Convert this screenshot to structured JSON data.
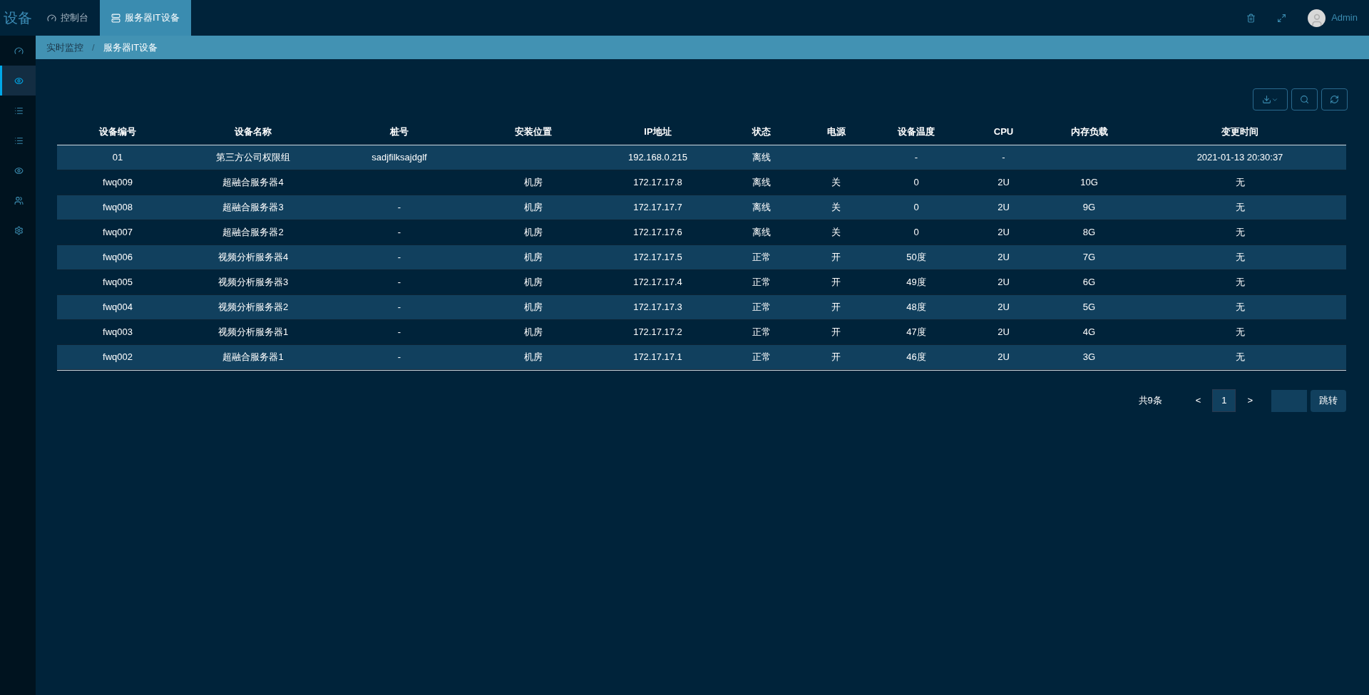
{
  "header": {
    "logo": "设备",
    "tabs": [
      {
        "label": "控制台",
        "selected": false
      },
      {
        "label": "服务器IT设备",
        "selected": true
      }
    ],
    "user": "Admin"
  },
  "sidebar": {
    "items": [
      {
        "selected": false
      },
      {
        "selected": true
      },
      {
        "selected": false
      },
      {
        "selected": false
      },
      {
        "selected": false
      },
      {
        "selected": false
      },
      {
        "selected": false
      }
    ]
  },
  "breadcrumb": {
    "items": [
      "实时监控",
      "服务器IT设备"
    ],
    "separator": "/"
  },
  "table": {
    "columns": [
      "设备编号",
      "设备名称",
      "桩号",
      "安装位置",
      "IP地址",
      "状态",
      "电源",
      "设备温度",
      "CPU",
      "内存负载",
      "变更时间"
    ],
    "rows": [
      [
        "01",
        "第三方公司权限组",
        "sadjfilksajdglf",
        "",
        "192.168.0.215",
        "离线",
        "",
        "-",
        "-",
        "",
        "2021-01-13 20:30:37"
      ],
      [
        "fwq009",
        "超融合服务器4",
        "",
        "机房",
        "172.17.17.8",
        "离线",
        "关",
        "0",
        "2U",
        "10G",
        "无"
      ],
      [
        "fwq008",
        "超融合服务器3",
        "-",
        "机房",
        "172.17.17.7",
        "离线",
        "关",
        "0",
        "2U",
        "9G",
        "无"
      ],
      [
        "fwq007",
        "超融合服务器2",
        "-",
        "机房",
        "172.17.17.6",
        "离线",
        "关",
        "0",
        "2U",
        "8G",
        "无"
      ],
      [
        "fwq006",
        "视频分析服务器4",
        "-",
        "机房",
        "172.17.17.5",
        "正常",
        "开",
        "50度",
        "2U",
        "7G",
        "无"
      ],
      [
        "fwq005",
        "视频分析服务器3",
        "-",
        "机房",
        "172.17.17.4",
        "正常",
        "开",
        "49度",
        "2U",
        "6G",
        "无"
      ],
      [
        "fwq004",
        "视频分析服务器2",
        "-",
        "机房",
        "172.17.17.3",
        "正常",
        "开",
        "48度",
        "2U",
        "5G",
        "无"
      ],
      [
        "fwq003",
        "视频分析服务器1",
        "-",
        "机房",
        "172.17.17.2",
        "正常",
        "开",
        "47度",
        "2U",
        "4G",
        "无"
      ],
      [
        "fwq002",
        "超融合服务器1",
        "-",
        "机房",
        "172.17.17.1",
        "正常",
        "开",
        "46度",
        "2U",
        "3G",
        "无"
      ]
    ]
  },
  "pagination": {
    "total": "共9条",
    "prev": "<",
    "pages": [
      {
        "label": "1",
        "selected": true
      }
    ],
    "next": ">",
    "jump": "跳转"
  }
}
